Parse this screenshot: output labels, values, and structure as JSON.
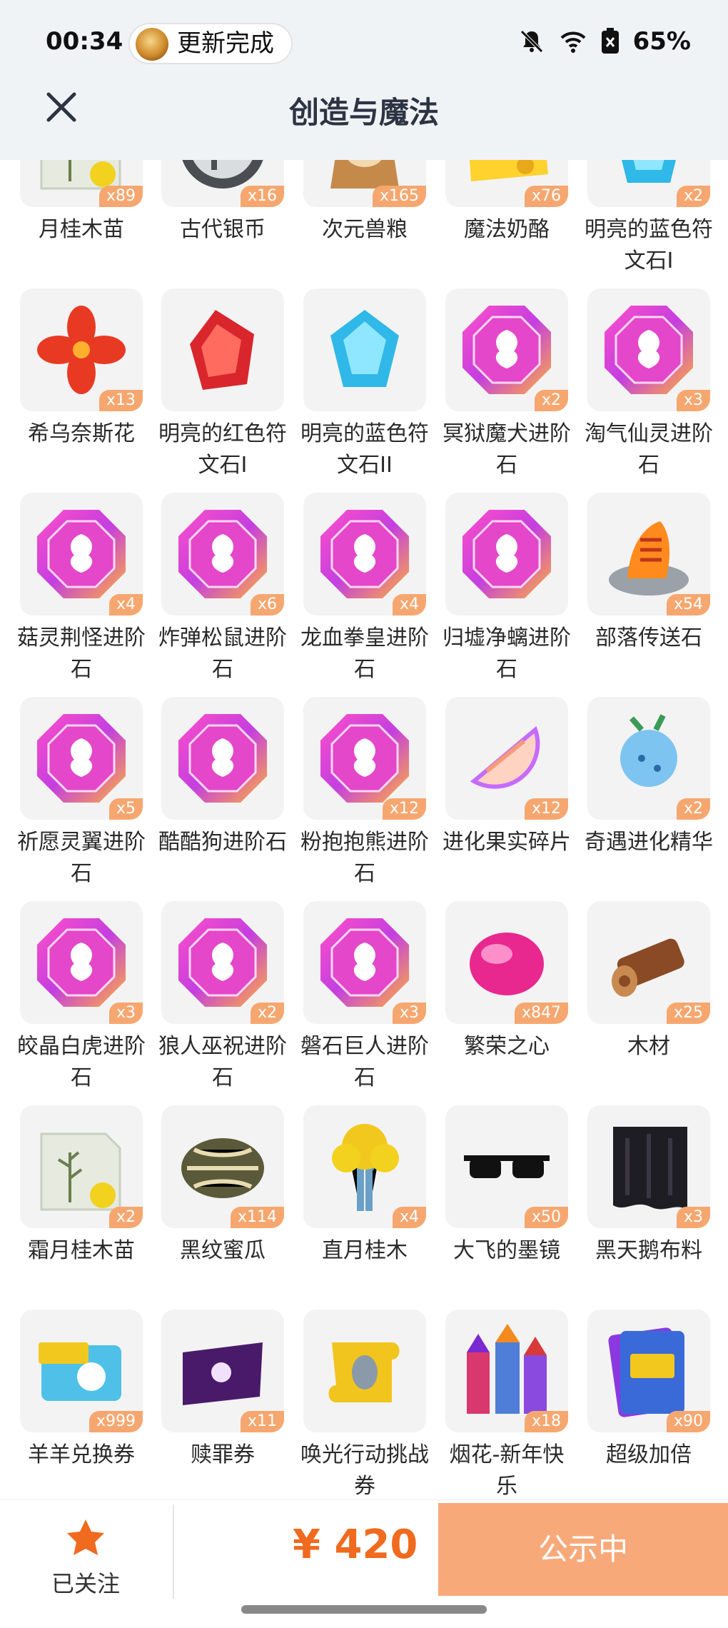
{
  "status": {
    "time": "00:34",
    "update_text": "更新完成",
    "battery": "65%"
  },
  "nav": {
    "title": "创造与魔法"
  },
  "items": [
    {
      "name": "月桂木苗",
      "qty": "x89",
      "art": "sapling"
    },
    {
      "name": "古代银币",
      "qty": "x16",
      "art": "coin"
    },
    {
      "name": "次元兽粮",
      "qty": "x165",
      "art": "bag"
    },
    {
      "name": "魔法奶酪",
      "qty": "x76",
      "art": "cheese"
    },
    {
      "name": "明亮的蓝色符文石I",
      "qty": "x2",
      "art": "blue-gem"
    },
    {
      "name": "希乌奈斯花",
      "qty": "x13",
      "art": "flower"
    },
    {
      "name": "明亮的红色符文石I",
      "qty": "",
      "art": "red-gem"
    },
    {
      "name": "明亮的蓝色符文石II",
      "qty": "",
      "art": "blue-gem"
    },
    {
      "name": "冥狱魔犬进阶石",
      "qty": "x2",
      "art": "pink-stone"
    },
    {
      "name": "淘气仙灵进阶石",
      "qty": "x3",
      "art": "pink-stone"
    },
    {
      "name": "菇灵荆怪进阶石",
      "qty": "x4",
      "art": "pink-stone"
    },
    {
      "name": "炸弹松鼠进阶石",
      "qty": "x6",
      "art": "pink-stone"
    },
    {
      "name": "龙血拳皇进阶石",
      "qty": "x4",
      "art": "pink-stone"
    },
    {
      "name": "归墟净螭进阶石",
      "qty": "",
      "art": "pink-stone"
    },
    {
      "name": "部落传送石",
      "qty": "x54",
      "art": "teleport"
    },
    {
      "name": "祈愿灵翼进阶石",
      "qty": "x5",
      "art": "pink-stone"
    },
    {
      "name": "酷酷狗进阶石",
      "qty": "",
      "art": "pink-stone"
    },
    {
      "name": "粉抱抱熊进阶石",
      "qty": "x12",
      "art": "pink-stone"
    },
    {
      "name": "进化果实碎片",
      "qty": "x12",
      "art": "fruit"
    },
    {
      "name": "奇遇进化精华",
      "qty": "x2",
      "art": "essence"
    },
    {
      "name": "皎晶白虎进阶石",
      "qty": "x3",
      "art": "pink-stone"
    },
    {
      "name": "狼人巫祝进阶石",
      "qty": "x2",
      "art": "pink-stone"
    },
    {
      "name": "磐石巨人进阶石",
      "qty": "x3",
      "art": "pink-stone"
    },
    {
      "name": "繁荣之心",
      "qty": "x847",
      "art": "heart"
    },
    {
      "name": "木材",
      "qty": "x25",
      "art": "wood"
    },
    {
      "name": "霜月桂木苗",
      "qty": "x2",
      "art": "sapling"
    },
    {
      "name": "黑纹蜜瓜",
      "qty": "x114",
      "art": "melon"
    },
    {
      "name": "直月桂木",
      "qty": "x4",
      "art": "tree"
    },
    {
      "name": "大飞的墨镜",
      "qty": "x50",
      "art": "glasses"
    },
    {
      "name": "黑天鹅布料",
      "qty": "x3",
      "art": "cloth"
    },
    {
      "name": "羊羊兑换券",
      "qty": "x999",
      "art": "ticket"
    },
    {
      "name": "赎罪券",
      "qty": "x11",
      "art": "purple-ticket"
    },
    {
      "name": "唤光行动挑战券",
      "qty": "",
      "art": "scroll"
    },
    {
      "name": "烟花-新年快乐",
      "qty": "x18",
      "art": "firework"
    },
    {
      "name": "超级加倍",
      "qty": "x90",
      "art": "cards"
    }
  ],
  "bottom": {
    "follow_label": "已关注",
    "price": "¥ 420",
    "status_button": "公示中"
  },
  "colors": {
    "accent": "#f06a1f",
    "qty_badge": "#f6a770",
    "status_button": "#f8a97a"
  }
}
